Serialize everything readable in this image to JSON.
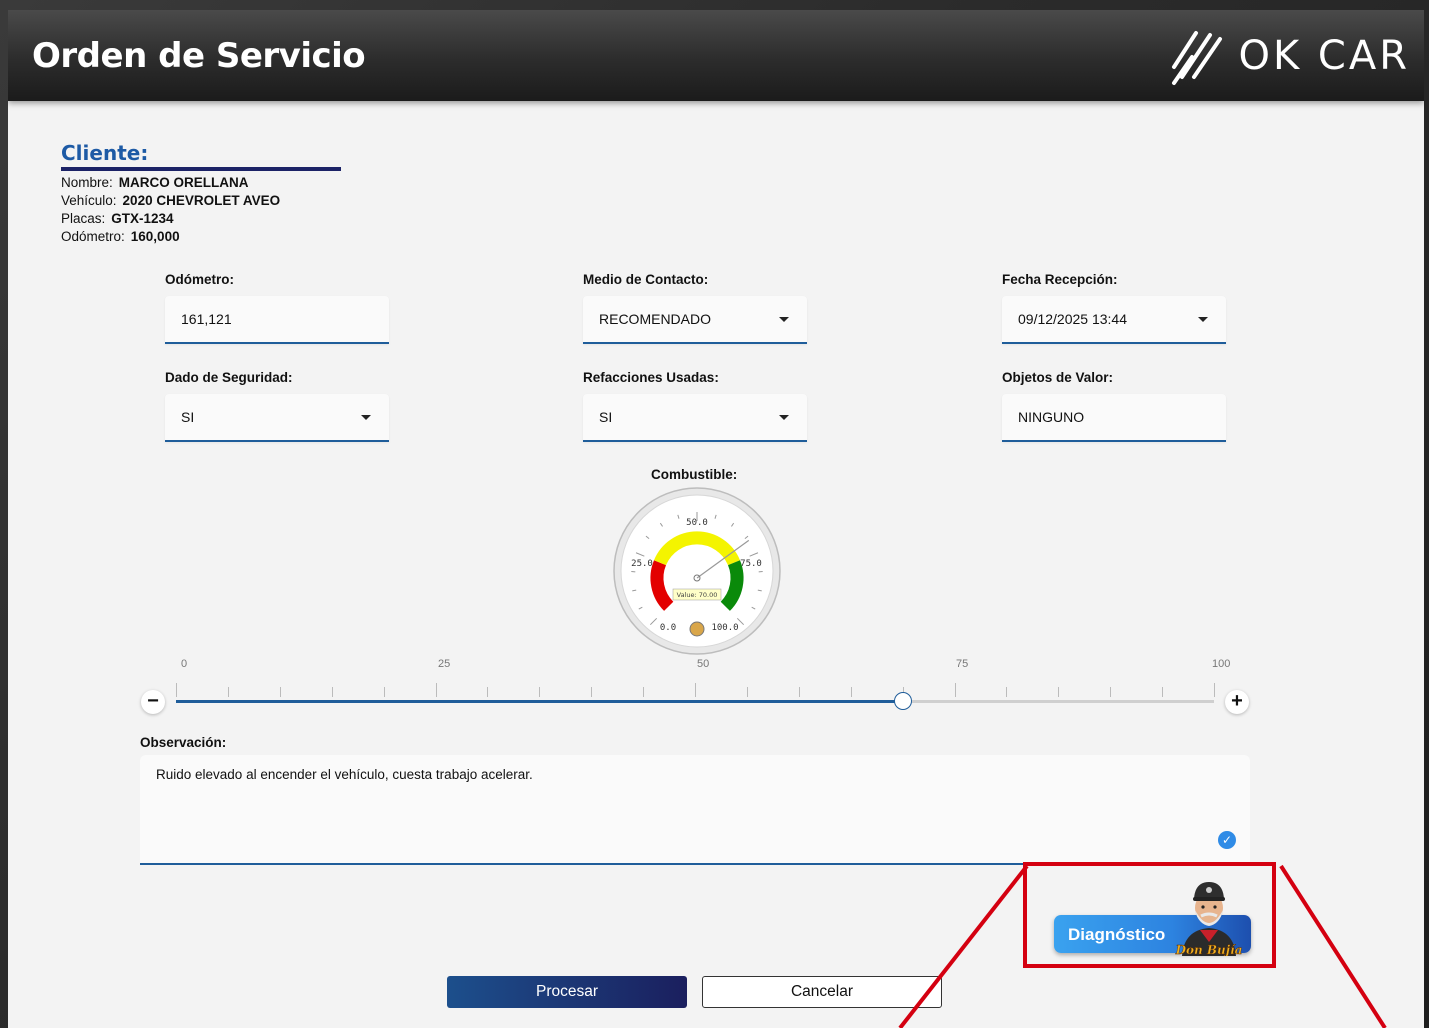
{
  "header": {
    "title": "Orden de Servicio",
    "brand": "OK CAR"
  },
  "client": {
    "heading": "Cliente:",
    "rows": [
      {
        "label": "Nombre:",
        "value": "MARCO ORELLANA"
      },
      {
        "label": "Vehículo:",
        "value": "2020 CHEVROLET AVEO"
      },
      {
        "label": "Placas:",
        "value": "GTX-1234"
      },
      {
        "label": "Odómetro:",
        "value": "160,000"
      }
    ]
  },
  "form": {
    "odometer": {
      "label": "Odómetro:",
      "value": "161,121"
    },
    "contact": {
      "label": "Medio de Contacto:",
      "value": "RECOMENDADO"
    },
    "reception_date": {
      "label": "Fecha Recepción:",
      "value": "09/12/2025 13:44"
    },
    "security_die": {
      "label": "Dado de Seguridad:",
      "value": "SI"
    },
    "used_parts": {
      "label": "Refacciones Usadas:",
      "value": "SI"
    },
    "valuables": {
      "label": "Objetos de Valor:",
      "value": "NINGUNO"
    }
  },
  "fuel": {
    "label": "Combustible:",
    "gauge_value": 70,
    "gauge_ticks": [
      "0.0",
      "25.0",
      "50.0",
      "75.0",
      "100.0"
    ],
    "gauge_value_label": "Value: 70.00",
    "slider_value": 70,
    "scale_labels": [
      "0",
      "25",
      "50",
      "75",
      "100"
    ]
  },
  "observation": {
    "label": "Observación:",
    "text": "Ruido elevado al encender el vehículo, cuesta trabajo acelerar."
  },
  "diagnostic": {
    "label": "Diagnóstico",
    "mascot_label": "Don Bujía"
  },
  "actions": {
    "process": "Procesar",
    "cancel": "Cancelar"
  },
  "colors": {
    "accent": "#1f5d9a",
    "highlight": "#d40010",
    "brand_dark": "#1b2266"
  },
  "icons": [
    "brand-logo-icon",
    "caret-down-icon",
    "minus-icon",
    "plus-icon",
    "check-icon",
    "mascot-icon"
  ]
}
